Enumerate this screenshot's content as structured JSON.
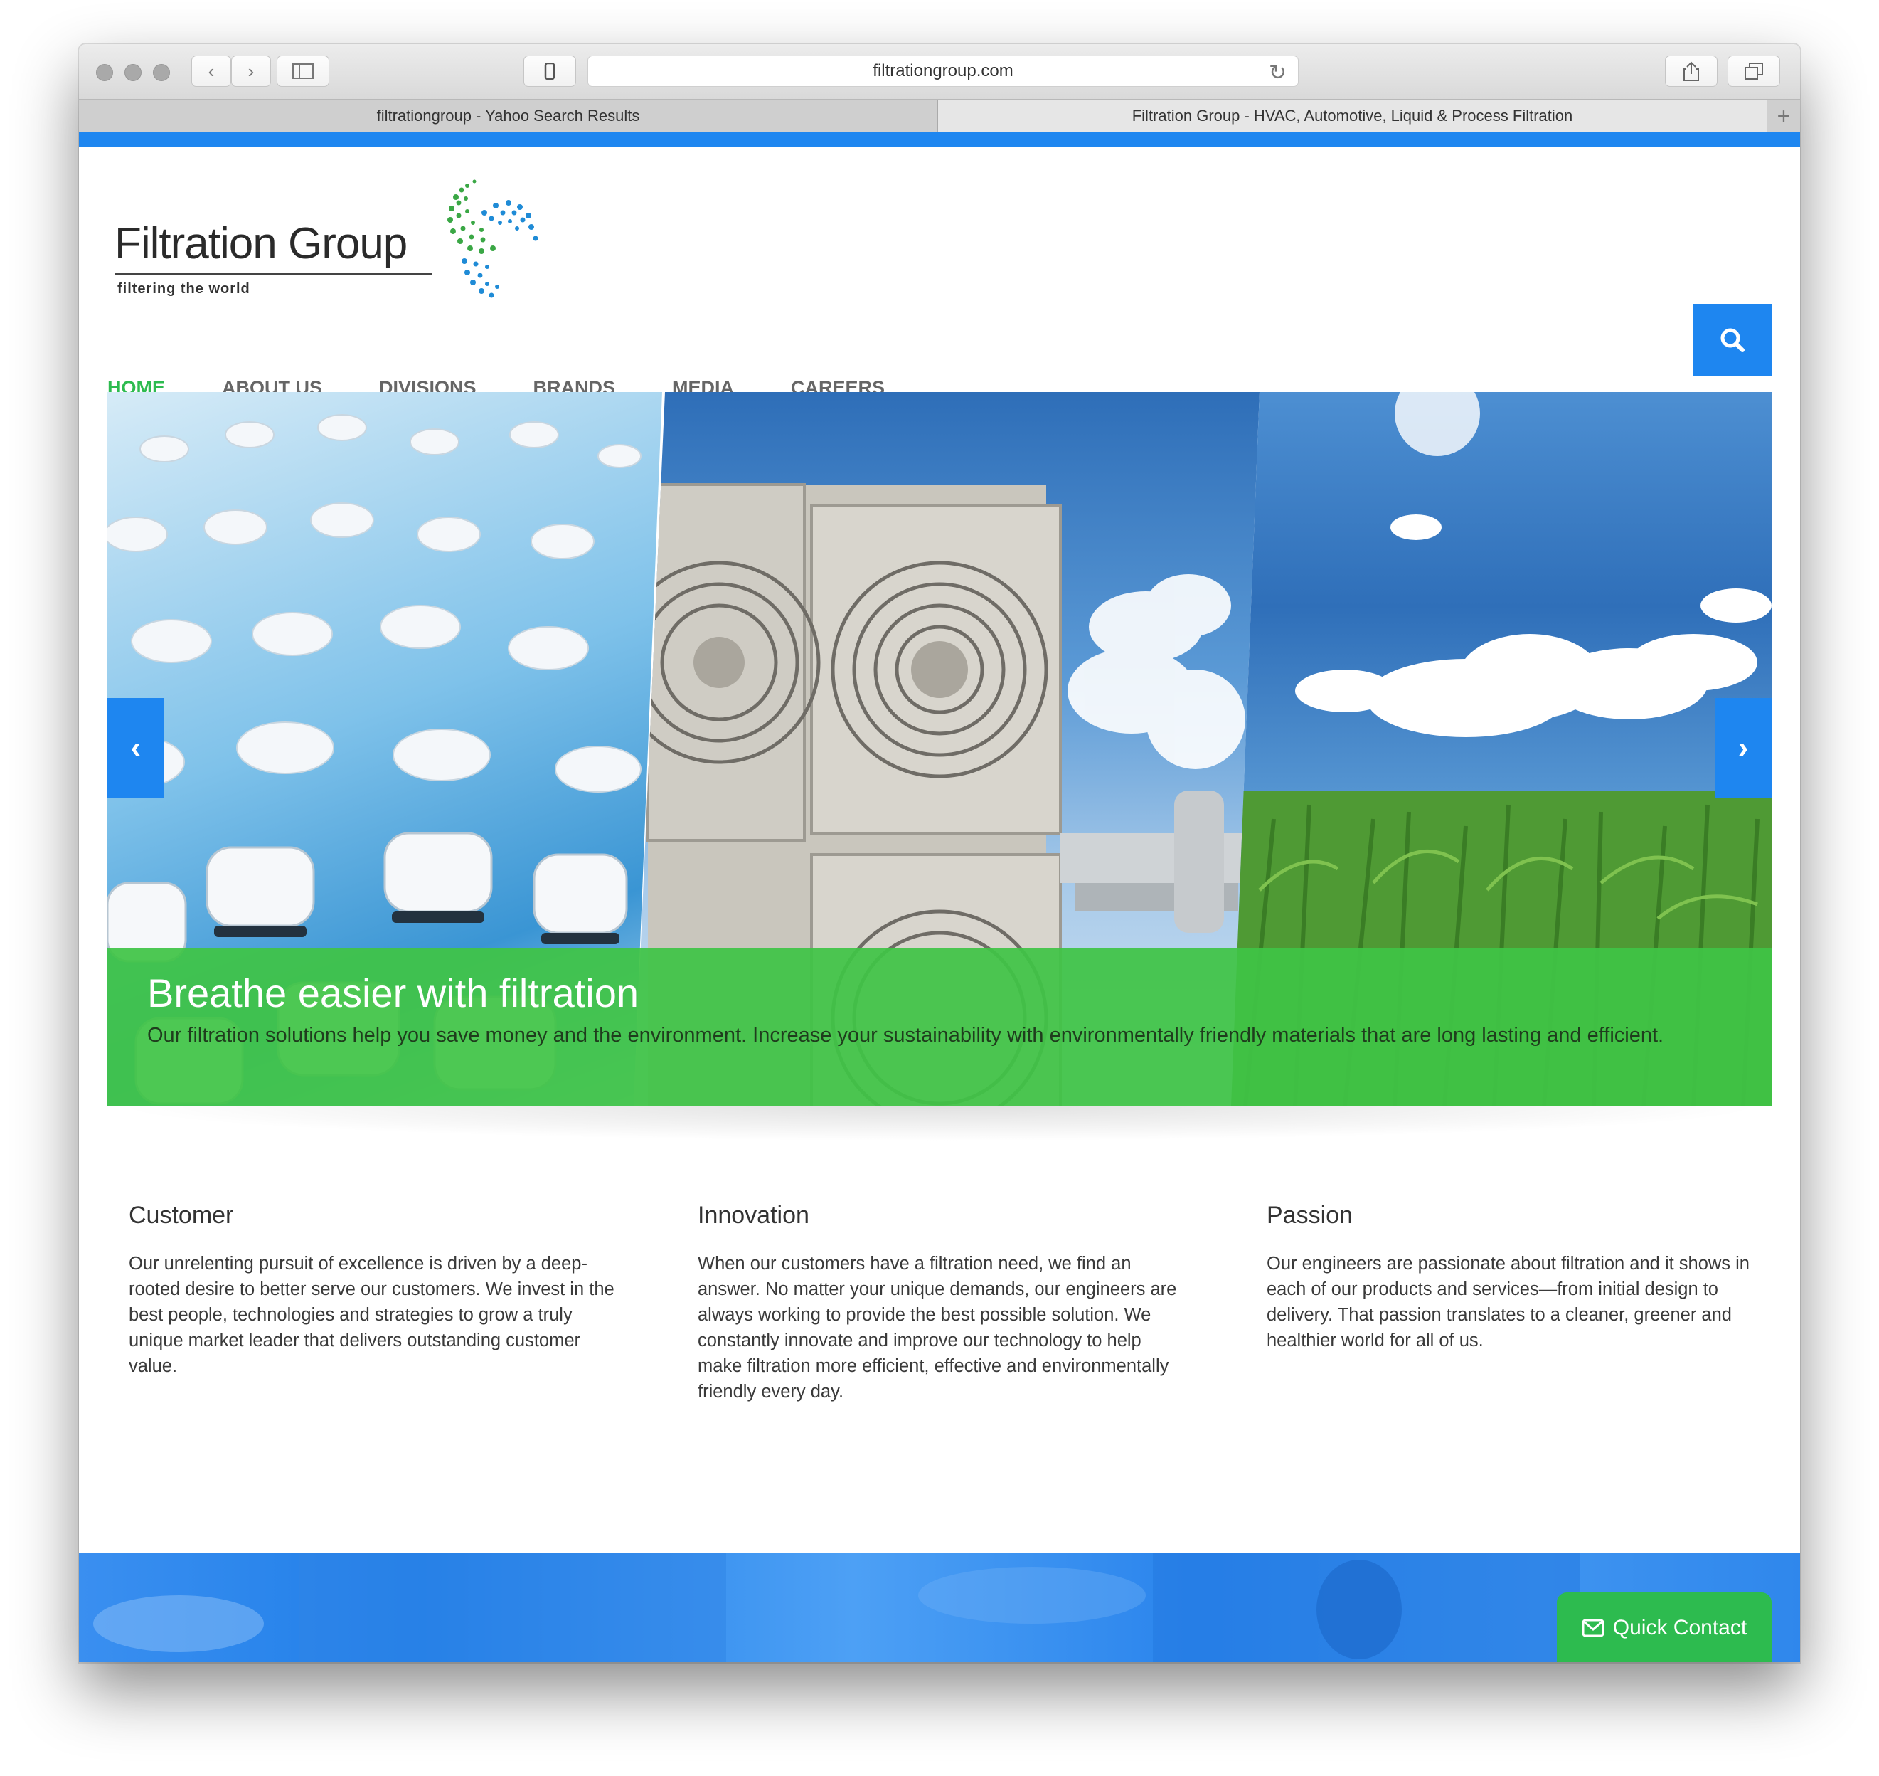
{
  "browser": {
    "url": "filtrationgroup.com",
    "tabs": [
      {
        "label": "filtrationgroup - Yahoo Search Results"
      },
      {
        "label": "Filtration Group - HVAC, Automotive, Liquid & Process Filtration"
      }
    ]
  },
  "logo": {
    "name": "Filtration Group",
    "tagline": "filtering the world"
  },
  "nav": {
    "items": [
      "HOME",
      "ABOUT US",
      "DIVISIONS",
      "BRANDS",
      "MEDIA",
      "CAREERS"
    ],
    "active": "HOME"
  },
  "hero": {
    "title": "Breathe easier with filtration",
    "text": "Our filtration solutions help you save money and the environment. Increase your sustainability with environmentally friendly materials that are long lasting and efficient."
  },
  "columns": [
    {
      "title": "Customer",
      "text": "Our unrelenting pursuit of excellence is driven by a deep-rooted desire to better serve our customers. We invest in the best people, technologies and strategies to grow a truly unique market leader that delivers outstanding customer value."
    },
    {
      "title": "Innovation",
      "text": "When our customers have a filtration need, we find an answer. No matter your unique demands, our engineers are always working to provide the best possible solution. We constantly innovate and improve our technology to help make filtration more efficient, effective and environmentally friendly every day."
    },
    {
      "title": "Passion",
      "text": "Our engineers are passionate about filtration and it shows in each of our products and services—from initial design to delivery. That passion translates to a cleaner, greener and healthier world for all of us."
    }
  ],
  "quick_contact": {
    "label": "Quick Contact"
  },
  "icons": {
    "search": "search-icon",
    "prev": "chevron-left-icon",
    "next": "chevron-right-icon",
    "contact": "envelope-icon"
  },
  "colors": {
    "accent_blue": "#1e86f0",
    "accent_green": "#2dbb4f",
    "caption_green": "#3fc446"
  }
}
